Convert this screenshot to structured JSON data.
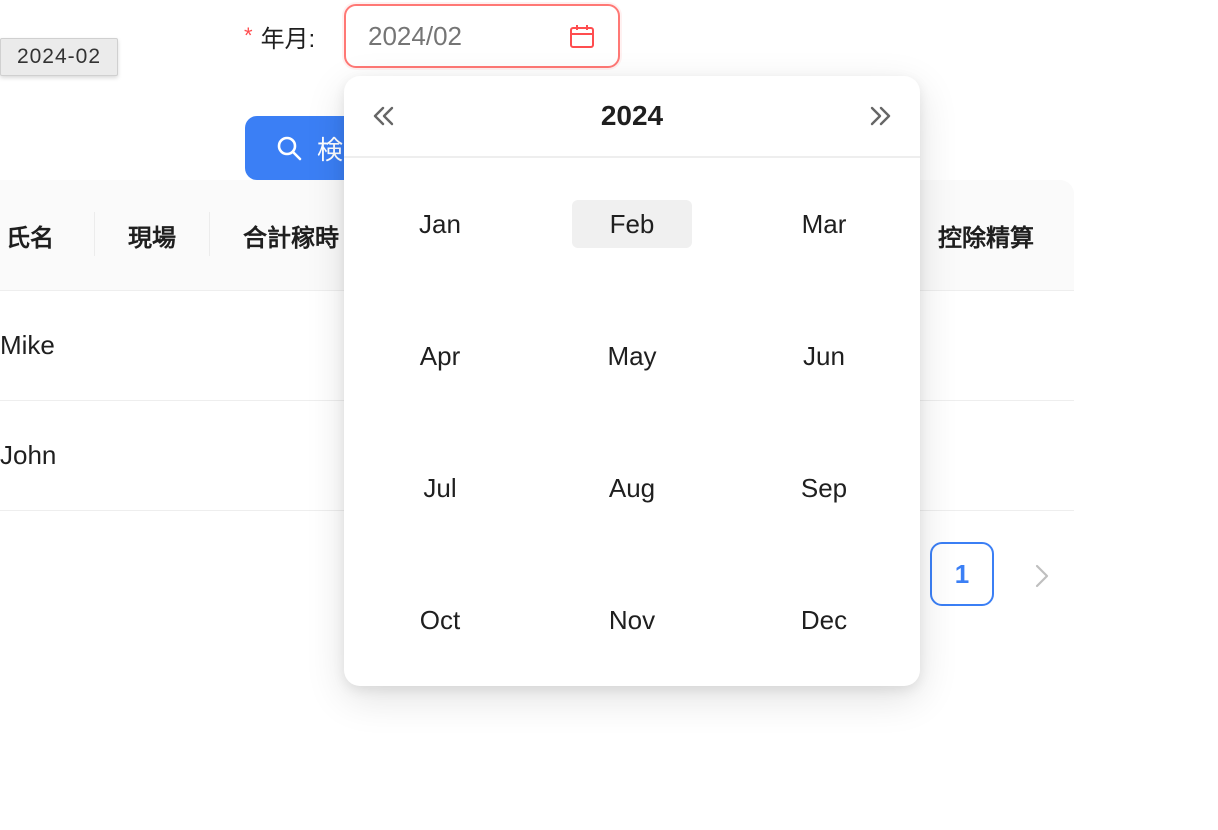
{
  "tooltip": {
    "text": "2024-02"
  },
  "form": {
    "required_mark": "*",
    "label": "年月:",
    "input_value": "2024/02"
  },
  "search": {
    "label": "検"
  },
  "table": {
    "headers": [
      "氏名",
      "現場",
      "合計稼時",
      "控除精算"
    ],
    "rows": [
      {
        "name": "Mike"
      },
      {
        "name": "John"
      }
    ]
  },
  "pagination": {
    "current_page": "1"
  },
  "picker": {
    "year": "2024",
    "selected_month": "Feb",
    "months": [
      "Jan",
      "Feb",
      "Mar",
      "Apr",
      "May",
      "Jun",
      "Jul",
      "Aug",
      "Sep",
      "Oct",
      "Nov",
      "Dec"
    ]
  },
  "colors": {
    "primary": "#3b7ff5",
    "error": "#ff4d4f"
  },
  "icons": [
    "calendar-icon",
    "search-icon",
    "double-left-icon",
    "double-right-icon",
    "chevron-right-icon"
  ]
}
